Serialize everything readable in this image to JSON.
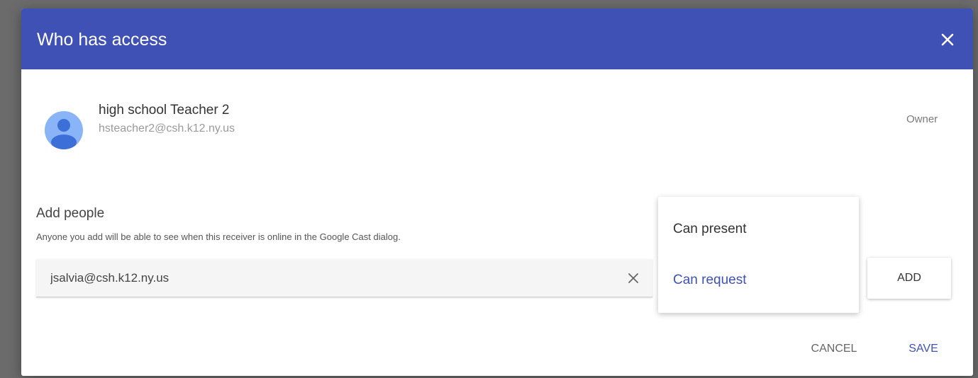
{
  "dialog": {
    "title": "Who has access",
    "header_color": "#3f51b5",
    "close_icon": "close-icon"
  },
  "owner": {
    "name": "high school Teacher 2",
    "email": "hsteacher2@csh.k12.ny.us",
    "role": "Owner",
    "avatar_icon": "person-icon",
    "avatar_color": "#8ab4f8"
  },
  "add_people": {
    "title": "Add people",
    "description": "Anyone you add will be able to see when this receiver is online in the Google Cast dialog.",
    "input_value": "jsalvia@csh.k12.ny.us",
    "clear_icon": "clear-icon",
    "add_label": "ADD"
  },
  "permission_menu": {
    "options": [
      "Can present",
      "Can request"
    ],
    "selected": "Can request",
    "selected_color": "#3f51b5"
  },
  "actions": {
    "cancel_label": "CANCEL",
    "save_label": "SAVE"
  }
}
